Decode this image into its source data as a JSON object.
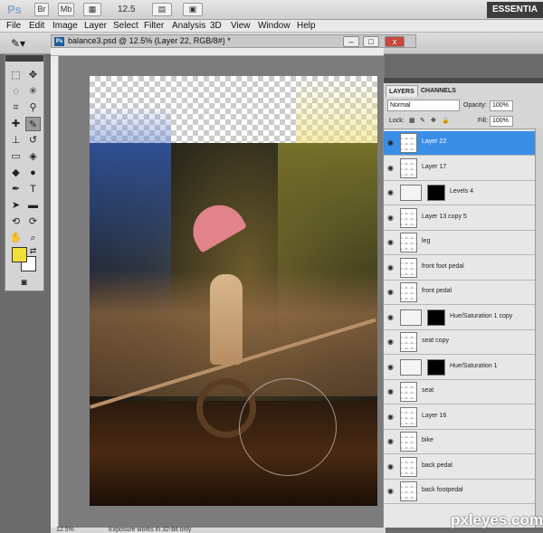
{
  "appbar": {
    "logo": "Ps",
    "br": "Br",
    "mb": "Mb",
    "zoom": "12.5",
    "workspace": "ESSENTIA"
  },
  "menu": [
    "File",
    "Edit",
    "Image",
    "Layer",
    "Select",
    "Filter",
    "Analysis",
    "3D",
    "View",
    "Window",
    "Help"
  ],
  "document": {
    "tab_title": "balance3.psd @ 12.5% (Layer 22, RGB/8#) *",
    "ps_icon": "Ps",
    "min": "–",
    "max": "□",
    "close": "x"
  },
  "status": {
    "zoom": "12.5%",
    "message": "Exposure works in 32-bit only"
  },
  "panel": {
    "tabs": [
      "LAYERS",
      "CHANNELS"
    ],
    "blend_mode": "Normal",
    "opacity_label": "Opacity:",
    "opacity": "100%",
    "lock_label": "Lock:",
    "fill_label": "Fill:",
    "fill": "100%",
    "layers": [
      {
        "name": "Layer 22",
        "type": "pixel",
        "selected": true
      },
      {
        "name": "Layer 17",
        "type": "pixel"
      },
      {
        "name": "Levels 4",
        "type": "adjustment"
      },
      {
        "name": "Layer 13 copy 5",
        "type": "pixel"
      },
      {
        "name": "leg",
        "type": "pixel"
      },
      {
        "name": "front foot pedal",
        "type": "pixel"
      },
      {
        "name": "front pedal",
        "type": "pixel"
      },
      {
        "name": "Hue/Saturation 1 copy",
        "type": "adjustment"
      },
      {
        "name": "seat copy",
        "type": "pixel"
      },
      {
        "name": "Hue/Saturation 1",
        "type": "adjustment"
      },
      {
        "name": "seat",
        "type": "pixel"
      },
      {
        "name": "Layer 16",
        "type": "pixel"
      },
      {
        "name": "bike",
        "type": "pixel"
      },
      {
        "name": "back pedal",
        "type": "pixel"
      },
      {
        "name": "back footpedal",
        "type": "pixel"
      }
    ]
  },
  "colors": {
    "foreground": "#efe03a",
    "background": "#ffffff",
    "selected_layer": "#3a8ee6"
  },
  "watermark": "pxleyes.com"
}
